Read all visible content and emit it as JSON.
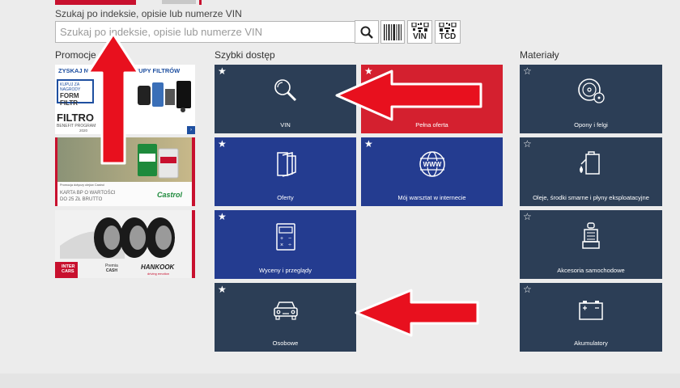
{
  "search": {
    "label": "Szukaj po indeksie, opisie lub numerze VIN",
    "placeholder": "Szukaj po indeksie, opisie lub numerze VIN",
    "value": "",
    "buttons": [
      {
        "name": "search",
        "icon": "magnifier-icon"
      },
      {
        "name": "barcode",
        "icon": "barcode-icon"
      },
      {
        "name": "qr-vin",
        "icon": "qr-vin-icon",
        "text": "VIN"
      },
      {
        "name": "qr-tcd",
        "icon": "qr-tcd-icon",
        "text": "TCD"
      }
    ]
  },
  "sections": {
    "promocje": "Promocje",
    "szybki": "Szybki dostęp",
    "materialy": "Materiały"
  },
  "promos": [
    {
      "headline": "ZYSKAJ NAGRODY ZA ZAKUPY FILTRÓW",
      "lines": [
        "KUPUJ ZA NAGRODY",
        "FORM",
        "FILTR"
      ],
      "brand": "FILTRO",
      "sub": "BENEFIT PROGRAM",
      "year": "2020"
    },
    {
      "headline": "Promocja dotyczy olejów Castrol",
      "lines": [
        "KARTA BP O WARTOŚCI",
        "DO 25 ZŁ BRUTTO"
      ],
      "brand": "Castrol"
    },
    {
      "brand": "HANKOOK",
      "sub": "driving emotion",
      "lines": [
        "INTER",
        "CARS",
        "Premia",
        "CASH"
      ]
    }
  ],
  "tiles": {
    "quick": [
      {
        "label": "VIN",
        "icon": "magnifier-icon",
        "color": "#2c3e56"
      },
      {
        "label": "Pełna oferta",
        "icon": "dial-icon",
        "color": "#d4202f"
      },
      {
        "label": "Oferty",
        "icon": "catalog-pages-icon",
        "color": "#243c90"
      },
      {
        "label": "Mój warsztat w internecie",
        "icon": "globe-www-icon",
        "color": "#243c90"
      },
      {
        "label": "Wyceny i przeglądy",
        "icon": "calculator-icon",
        "color": "#243c90"
      },
      {
        "label": "Osobowe",
        "icon": "car-icon",
        "color": "#2c3e56"
      }
    ],
    "materials": [
      {
        "label": "Opony i felgi",
        "icon": "tire-icon",
        "color": "#2c3e56"
      },
      {
        "label": "Oleje, środki smarne i płyny eksploatacyjne",
        "icon": "oil-can-icon",
        "color": "#2c3e56"
      },
      {
        "label": "Akcesoria samochodowe",
        "icon": "car-seat-icon",
        "color": "#2c3e56"
      },
      {
        "label": "Akumulatory",
        "icon": "battery-icon",
        "color": "#2c3e56"
      }
    ]
  },
  "star_glyphs": {
    "filled": "★",
    "outline": "☆"
  },
  "colors": {
    "arrow": "#e8101e",
    "accent": "#c8102e"
  }
}
